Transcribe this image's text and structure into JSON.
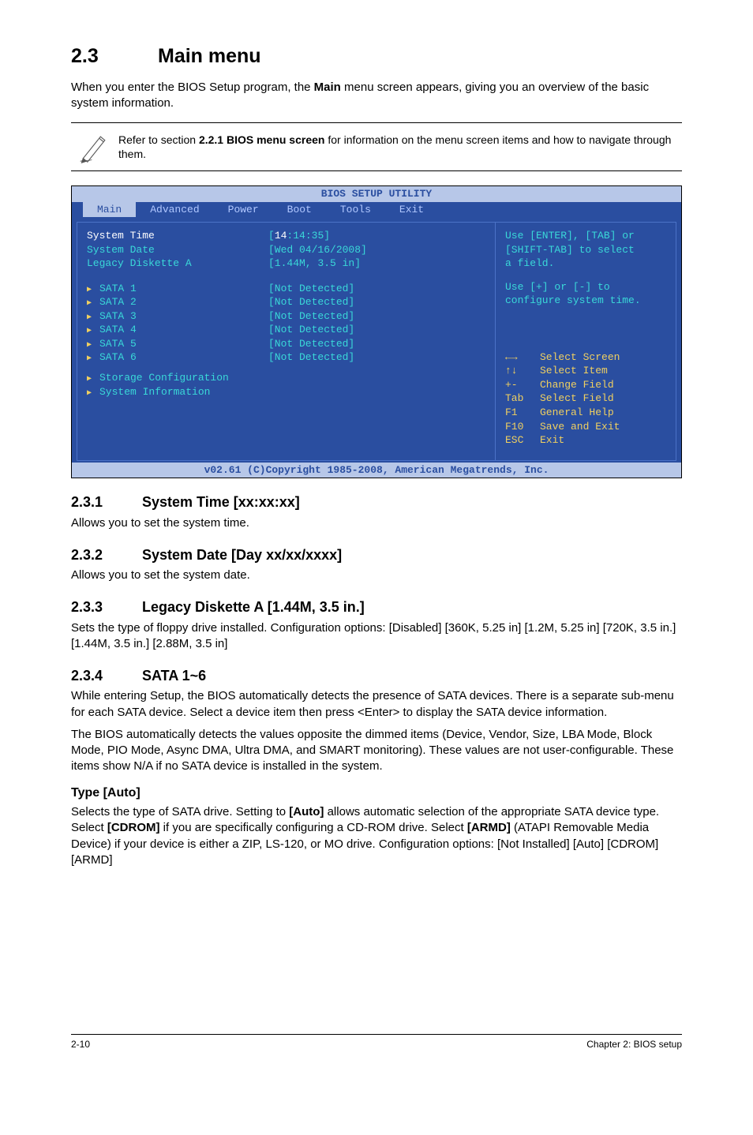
{
  "heading": {
    "num": "2.3",
    "title": "Main menu"
  },
  "intro_pre": "When you enter the BIOS Setup program, the ",
  "intro_bold": "Main",
  "intro_post": " menu screen appears, giving you an overview of the basic system information.",
  "note_pre": "Refer to section ",
  "note_bold": "2.2.1 BIOS menu screen",
  "note_post": " for information on the menu screen items and how to navigate through them.",
  "bios": {
    "title": "BIOS SETUP UTILITY",
    "menus": [
      "Main",
      "Advanced",
      "Power",
      "Boot",
      "Tools",
      "Exit"
    ],
    "time_lbl": "System Time",
    "time_h": "14",
    "time_c1": ":",
    "time_m": "14",
    "time_c2": ":",
    "time_s": "35",
    "date_lbl": "System Date",
    "date_val": "[Wed 04/16/2008]",
    "legacy_lbl": "Legacy Diskette A",
    "legacy_val": "[1.44M, 3.5 in]",
    "sata": [
      {
        "lbl": "SATA 1",
        "val": "[Not Detected]"
      },
      {
        "lbl": "SATA 2",
        "val": "[Not Detected]"
      },
      {
        "lbl": "SATA 3",
        "val": "[Not Detected]"
      },
      {
        "lbl": "SATA 4",
        "val": "[Not Detected]"
      },
      {
        "lbl": "SATA 5",
        "val": "[Not Detected]"
      },
      {
        "lbl": "SATA 6",
        "val": "[Not Detected]"
      }
    ],
    "storage": "Storage Configuration",
    "sysinfo": "System Information",
    "help_top1": "Use [ENTER], [TAB] or",
    "help_top2": "[SHIFT-TAB] to select",
    "help_top3": "a field.",
    "help_top4": "Use [+] or [-] to",
    "help_top5": "configure system time.",
    "help": [
      {
        "k": "←→",
        "v": "Select Screen"
      },
      {
        "k": "↑↓",
        "v": "Select Item"
      },
      {
        "k": "+-",
        "v": "Change Field"
      },
      {
        "k": "Tab",
        "v": "Select Field"
      },
      {
        "k": "F1",
        "v": "General Help"
      },
      {
        "k": "F10",
        "v": "Save and Exit"
      },
      {
        "k": "ESC",
        "v": "Exit"
      }
    ],
    "footer": "v02.61 (C)Copyright 1985-2008, American Megatrends, Inc."
  },
  "s231": {
    "num": "2.3.1",
    "title": "System Time [xx:xx:xx]",
    "text": "Allows you to set the system time."
  },
  "s232": {
    "num": "2.3.2",
    "title": "System Date [Day xx/xx/xxxx]",
    "text": "Allows you to set the system date."
  },
  "s233": {
    "num": "2.3.3",
    "title": "Legacy Diskette A [1.44M, 3.5 in.]",
    "text": "Sets the type of floppy drive installed. Configuration options: [Disabled] [360K, 5.25 in] [1.2M, 5.25 in] [720K, 3.5 in.] [1.44M, 3.5 in.] [2.88M, 3.5 in]"
  },
  "s234": {
    "num": "2.3.4",
    "title": "SATA 1~6",
    "p1": "While entering Setup, the BIOS automatically detects the presence of SATA devices. There is a separate sub-menu for each SATA device. Select a device item then press <Enter> to display the SATA device information.",
    "p2": "The BIOS automatically detects the values opposite the dimmed items (Device, Vendor, Size, LBA Mode, Block Mode, PIO Mode, Async DMA, Ultra DMA, and SMART monitoring). These values are not user-configurable. These items show N/A if no SATA device is installed in the system."
  },
  "type": {
    "title": "Type [Auto]",
    "t1": "Selects the type of SATA drive. Setting to ",
    "b1": "[Auto]",
    "t2": " allows automatic selection of the appropriate SATA device type. Select ",
    "b2": "[CDROM]",
    "t3": " if you are specifically configuring a CD-ROM drive. Select ",
    "b3": "[ARMD]",
    "t4": " (ATAPI Removable Media Device) if your device is either a ZIP, LS-120, or MO drive. Configuration options: [Not Installed] [Auto] [CDROM] [ARMD]"
  },
  "footer": {
    "left": "2-10",
    "right": "Chapter 2: BIOS setup"
  }
}
